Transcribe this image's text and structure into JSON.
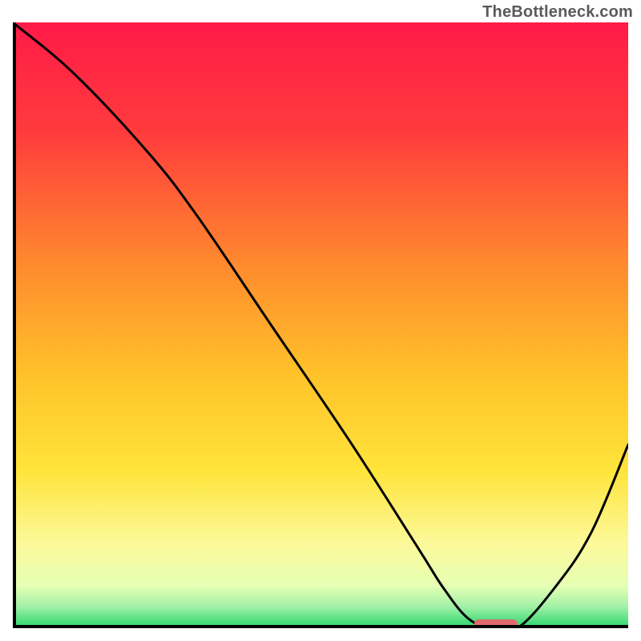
{
  "watermark": "TheBottleneck.com",
  "chart_data": {
    "type": "line",
    "title": "",
    "xlabel": "",
    "ylabel": "",
    "xlim": [
      0,
      100
    ],
    "ylim": [
      0,
      100
    ],
    "gradient_stops": [
      {
        "offset": 0.0,
        "color": "#ff1a47"
      },
      {
        "offset": 0.18,
        "color": "#ff3b3d"
      },
      {
        "offset": 0.4,
        "color": "#ff8a2e"
      },
      {
        "offset": 0.58,
        "color": "#ffc22a"
      },
      {
        "offset": 0.74,
        "color": "#ffe43a"
      },
      {
        "offset": 0.86,
        "color": "#fcf99a"
      },
      {
        "offset": 0.93,
        "color": "#e6ffb4"
      },
      {
        "offset": 0.965,
        "color": "#9ff0a6"
      },
      {
        "offset": 1.0,
        "color": "#27d66b"
      }
    ],
    "series": [
      {
        "name": "bottleneck-curve",
        "x": [
          0,
          10,
          22,
          30,
          42,
          55,
          66,
          70,
          74,
          78,
          82,
          88,
          94,
          100
        ],
        "y": [
          100,
          91.5,
          78.5,
          68,
          50,
          30.5,
          13,
          6.6,
          1.6,
          0,
          0,
          6.6,
          15.8,
          30.3
        ],
        "note": "y is percentage height of curve above bottom; approximated from pixels"
      }
    ],
    "marker": {
      "name": "optimal-band",
      "x_start": 75,
      "x_end": 82,
      "y": 0.8,
      "color": "#e16a6f"
    }
  }
}
